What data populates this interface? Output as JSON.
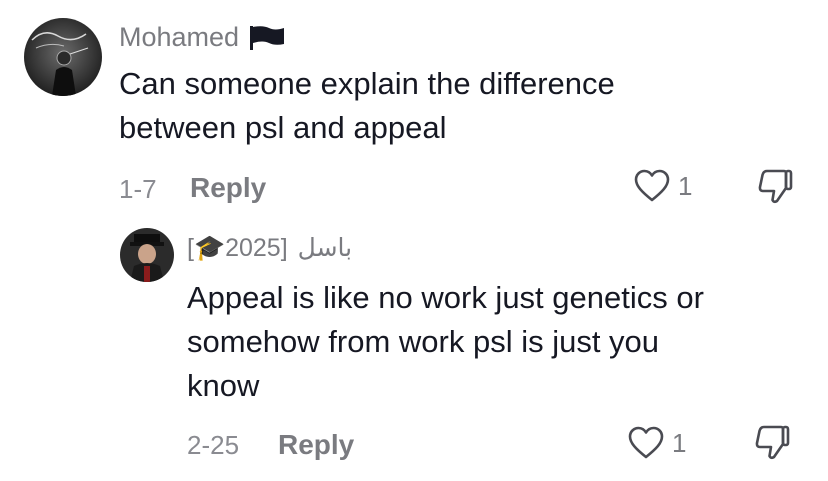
{
  "comments": [
    {
      "username": "Mohamed",
      "flag_icon": "black-flag-icon",
      "text_line1": "Can someone explain the difference",
      "text_line2": "between psl and appeal",
      "date": "1-7",
      "reply_label": "Reply",
      "likes": "1",
      "like_icon": "heart-outline-icon",
      "dislike_icon": "thumbs-down-icon"
    },
    {
      "username_prefix": "[🎓2025]",
      "username_arabic": "باسل",
      "text_line1": "Appeal is like no work just genetics or",
      "text_line2": "somehow from work psl is just you",
      "text_line3": "know",
      "date": "2-25",
      "reply_label": "Reply",
      "likes": "1",
      "like_icon": "heart-outline-icon",
      "dislike_icon": "thumbs-down-icon"
    }
  ],
  "colors": {
    "text": "#161823",
    "muted": "#7a7b80",
    "background": "#ffffff"
  }
}
